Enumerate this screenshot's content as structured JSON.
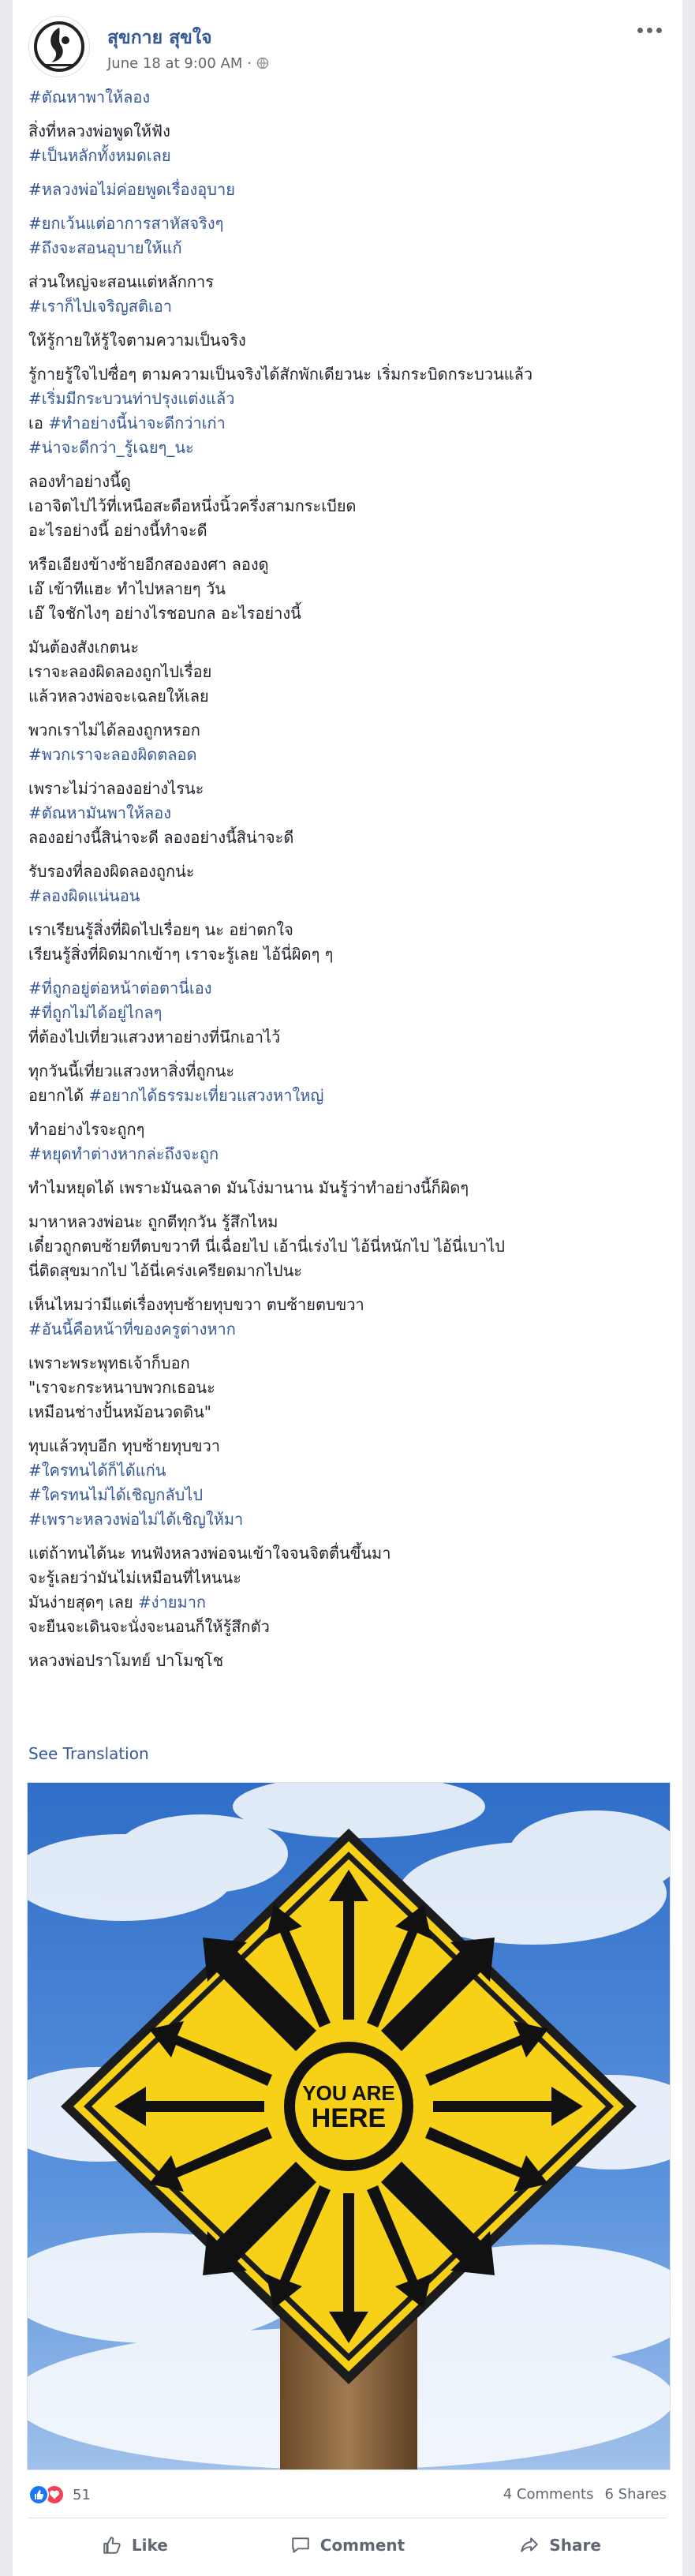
{
  "post": {
    "page_name": "สุขกาย สุขใจ",
    "timestamp": "June 18 at 9:00 AM",
    "privacy_icon": "globe-icon",
    "paragraphs": [
      [
        {
          "text": "#ตัณหาพาให้ลอง",
          "tag": true
        }
      ],
      [
        {
          "text": "สิ่งที่หลวงพ่อพูดให้ฟัง",
          "tag": false
        },
        {
          "text": "#เป็นหลักทั้งหมดเลย",
          "tag": true
        }
      ],
      [
        {
          "text": "#หลวงพ่อไม่ค่อยพูดเรื่องอุบาย",
          "tag": true
        }
      ],
      [
        {
          "text": "#ยกเว้นแต่อาการสาหัสจริงๆ",
          "tag": true
        },
        {
          "text": "#ถึงจะสอนอุบายให้แก้",
          "tag": true
        }
      ],
      [
        {
          "text": "ส่วนใหญ่จะสอนแต่หลักการ",
          "tag": false
        },
        {
          "text": "#เราก็ไปเจริญสติเอา",
          "tag": true
        }
      ],
      [
        {
          "text": "ให้รู้กายให้รู้ใจตามความเป็นจริง",
          "tag": false
        }
      ],
      [
        {
          "text": "รู้กายรู้ใจไปซื่อๆ ตามความเป็นจริงได้สักพักเดียวนะ เริ่มกระบิดกระบวนแล้ว",
          "tag": false
        },
        {
          "text": "#เริ่มมีกระบวนท่าปรุงแต่งแล้ว",
          "tag": true
        },
        {
          "text": "เอ #ทำอย่างนี้น่าจะดีกว่าเก่า",
          "tag": "mixed1"
        },
        {
          "text": "#น่าจะดีกว่า_รู้เฉยๆ_นะ",
          "tag": true
        }
      ],
      [
        {
          "text": "ลองทำอย่างนี้ดู",
          "tag": false
        },
        {
          "text": "เอาจิตไปไว้ที่เหนือสะดือหนึ่งนิ้วครึ่งสามกระเบียด",
          "tag": false
        },
        {
          "text": "อะไรอย่างนี้ อย่างนี้ทำจะดี",
          "tag": false
        }
      ],
      [
        {
          "text": "หรือเอียงข้างซ้ายอีกสององศา ลองดู",
          "tag": false
        },
        {
          "text": "เอ๊ เข้าทีแฮะ ทำไปหลายๆ วัน",
          "tag": false
        },
        {
          "text": "เอ๊ ใจชักไงๆ อย่างไรชอบกล อะไรอย่างนี้",
          "tag": false
        }
      ],
      [
        {
          "text": "มันต้องสังเกตนะ",
          "tag": false
        },
        {
          "text": "เราจะลองผิดลองถูกไปเรื่อย",
          "tag": false
        },
        {
          "text": "แล้วหลวงพ่อจะเฉลยให้เลย",
          "tag": false
        }
      ],
      [
        {
          "text": "พวกเราไม่ได้ลองถูกหรอก",
          "tag": false
        },
        {
          "text": "#พวกเราจะลองผิดตลอด",
          "tag": true
        }
      ],
      [
        {
          "text": "เพราะไม่ว่าลองอย่างไรนะ",
          "tag": false
        },
        {
          "text": "#ตัณหามันพาให้ลอง",
          "tag": true
        },
        {
          "text": "ลองอย่างนี้สิน่าจะดี ลองอย่างนี้สิน่าจะดี",
          "tag": false
        }
      ],
      [
        {
          "text": "รับรองที่ลองผิดลองถูกน่ะ",
          "tag": false
        },
        {
          "text": "#ลองผิดแน่นอน",
          "tag": true
        }
      ],
      [
        {
          "text": "เราเรียนรู้สิ่งที่ผิดไปเรื่อยๆ นะ อย่าตกใจ",
          "tag": false
        },
        {
          "text": "เรียนรู้สิ่งที่ผิดมากเข้าๆ เราจะรู้เลย ไอ้นี่ผิดๆ ๆ",
          "tag": false
        }
      ],
      [
        {
          "text": "#ที่ถูกอยู่ต่อหน้าต่อตานี่เอง",
          "tag": true
        },
        {
          "text": "#ที่ถูกไม่ได้อยู่ไกลๆ",
          "tag": true
        },
        {
          "text": "ที่ต้องไปเที่ยวแสวงหาอย่างที่นึกเอาไว้",
          "tag": false
        }
      ],
      [
        {
          "text": "ทุกวันนี้เที่ยวแสวงหาสิ่งที่ถูกนะ",
          "tag": false
        },
        {
          "text": "อยากได้ #อยากได้ธรรมะเที่ยวแสวงหาใหญ่",
          "tag": "mixed2"
        }
      ],
      [
        {
          "text": "ทำอย่างไรจะถูกๆ",
          "tag": false
        },
        {
          "text": "#หยุดทำต่างหากล่ะถึงจะถูก",
          "tag": true
        }
      ],
      [
        {
          "text": "ทำไมหยุดได้ เพราะมันฉลาด มันโง่มานาน มันรู้ว่าทำอย่างนี้ก็ผิดๆ",
          "tag": false
        }
      ],
      [
        {
          "text": "มาหาหลวงพ่อนะ ถูกตีทุกวัน รู้สึกไหม",
          "tag": false
        },
        {
          "text": "เดี๋ยวถูกตบซ้ายทีตบขวาที นี่เฉื่อยไป เอ้านี่เร่งไป ไอ้นี่หนักไป ไอ้นี่เบาไป",
          "tag": false
        },
        {
          "text": "นี่ติดสุขมากไป ไอ้นี่เคร่งเครียดมากไปนะ",
          "tag": false
        }
      ],
      [
        {
          "text": "เห็นไหมว่ามีแต่เรื่องทุบซ้ายทุบขวา ตบซ้ายตบขวา",
          "tag": false
        },
        {
          "text": "#อันนี้คือหน้าที่ของครูต่างหาก",
          "tag": true
        }
      ],
      [
        {
          "text": "เพราะพระพุทธเจ้าก็บอก",
          "tag": false
        },
        {
          "text": "\"เราจะกระหนาบพวกเธอนะ",
          "tag": false
        },
        {
          "text": "เหมือนช่างปั้นหม้อนวดดิน\"",
          "tag": false
        }
      ],
      [
        {
          "text": "ทุบแล้วทุบอีก ทุบซ้ายทุบขวา",
          "tag": false
        },
        {
          "text": "#ใครทนได้ก็ได้แก่น",
          "tag": true
        },
        {
          "text": "#ใครทนไม่ได้เชิญกลับไป",
          "tag": true
        },
        {
          "text": "#เพราะหลวงพ่อไม่ได้เชิญให้มา",
          "tag": true
        }
      ],
      [
        {
          "text": "แต่ถ้าทนได้นะ ทนฟังหลวงพ่อจนเข้าใจจนจิตตื่นขึ้นมา",
          "tag": false
        },
        {
          "text": "จะรู้เลยว่ามันไม่เหมือนที่ไหนนะ",
          "tag": false
        },
        {
          "text": "มันง่ายสุดๆ เลย #ง่ายมาก",
          "tag": "mixed3"
        },
        {
          "text": "จะยืนจะเดินจะนั่งจะนอนก็ให้รู้สึกตัว",
          "tag": false
        }
      ],
      [
        {
          "text": "หลวงพ่อปราโมทย์ ปาโมชฺโช",
          "tag": false
        }
      ]
    ],
    "see_translation": "See Translation",
    "image": {
      "sign_text_1": "YOU ARE",
      "sign_text_2": "HERE"
    },
    "reaction_count": "51",
    "comments": "4 Comments",
    "shares": "6 Shares",
    "actions": {
      "like": "Like",
      "comment": "Comment",
      "share": "Share"
    },
    "colors": {
      "link": "#365899",
      "text": "#1d2129",
      "meta": "#616770",
      "sign_yellow": "#f7d117",
      "sky": "#3f7fd6"
    }
  }
}
